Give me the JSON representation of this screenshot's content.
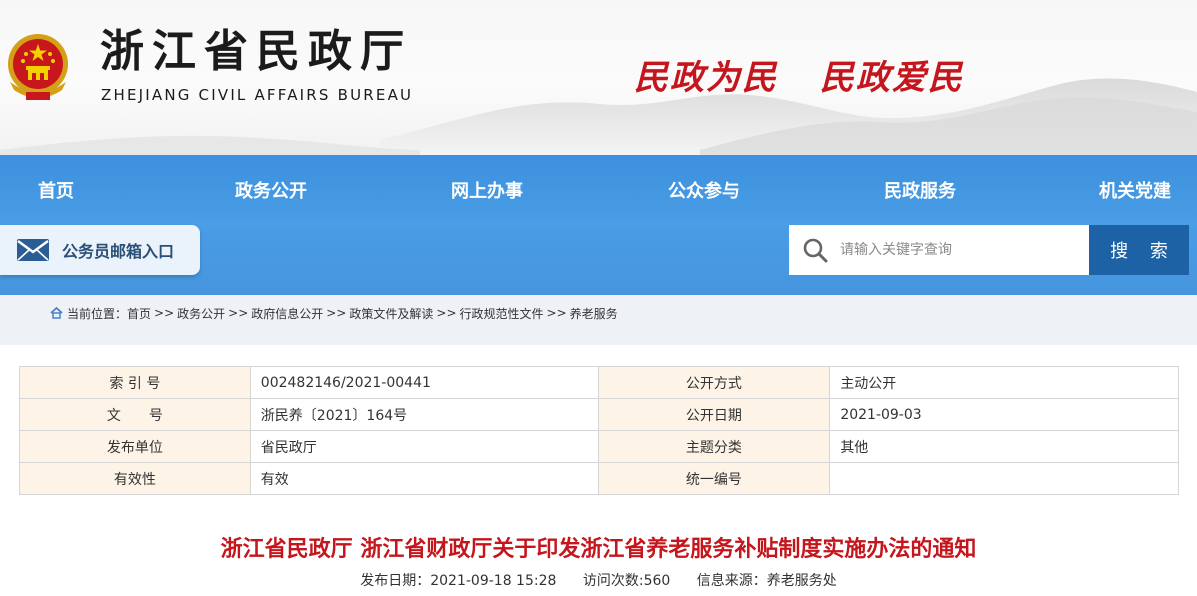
{
  "header": {
    "title": "浙江省民政厅",
    "subtitle": "ZHEJIANG CIVIL AFFAIRS BUREAU",
    "slogan_left": "民政为民",
    "slogan_right": "民政爱民"
  },
  "nav": {
    "items": [
      "首页",
      "政务公开",
      "网上办事",
      "公众参与",
      "民政服务",
      "机关党建"
    ]
  },
  "mailbox": {
    "label": "公务员邮箱入口",
    "icon": "mail-icon"
  },
  "search": {
    "placeholder": "请输入关键字查询",
    "button": "搜 索"
  },
  "breadcrumb": {
    "prefix": "当前位置：",
    "items": [
      "首页",
      "政务公开",
      "政府信息公开",
      "政策文件及解读",
      "行政规范性文件",
      "养老服务"
    ],
    "separator": ">>"
  },
  "info_table": {
    "rows": [
      {
        "k1": "索 引 号",
        "v1": "002482146/2021-00441",
        "k2": "公开方式",
        "v2": "主动公开"
      },
      {
        "k1": "文　　号",
        "v1": "浙民养〔2021〕164号",
        "k2": "公开日期",
        "v2": "2021-09-03"
      },
      {
        "k1": "发布单位",
        "v1": "省民政厅",
        "k2": "主题分类",
        "v2": "其他"
      },
      {
        "k1": "有效性",
        "v1": "有效",
        "k2": "统一编号",
        "v2": ""
      }
    ]
  },
  "article": {
    "title": "浙江省民政厅 浙江省财政厅关于印发浙江省养老服务补贴制度实施办法的通知",
    "publish_date": "发布日期：2021-09-18 15:28",
    "visits": "访问次数:560",
    "source": "信息来源：养老服务处"
  },
  "colors": {
    "nav_blue": "#4a9ee6",
    "search_button": "#1e62a6",
    "title_red": "#c4161c",
    "table_key_bg": "#fdf3e7"
  }
}
